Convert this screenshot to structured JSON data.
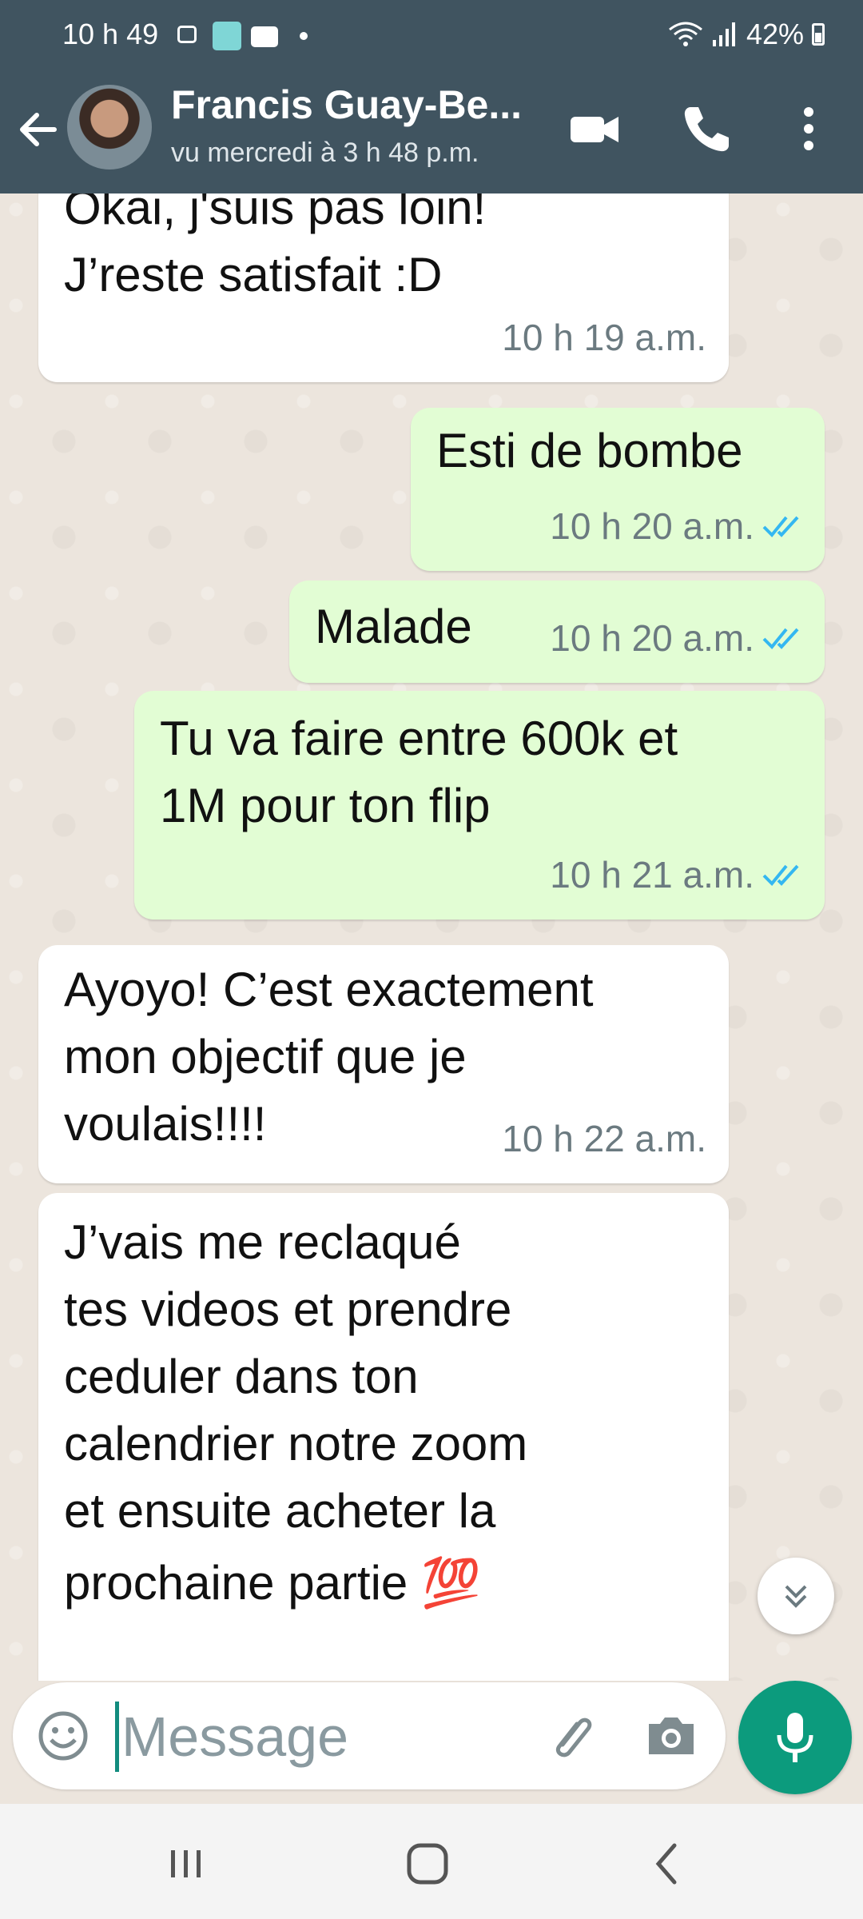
{
  "status_bar": {
    "time": "10 h 49",
    "battery": "42%"
  },
  "header": {
    "contact_name": "Francis Guay-Be...",
    "last_seen": "vu mercredi à 3 h 48 p.m."
  },
  "messages": [
    {
      "direction": "incoming",
      "lines": [
        "Okai, j'suis pas loin!",
        "J’reste satisfait :D"
      ],
      "time": "10 h 19 a.m."
    },
    {
      "direction": "outgoing",
      "lines": [
        "Esti de bombe"
      ],
      "time": "10 h 20 a.m.",
      "status": "read"
    },
    {
      "direction": "outgoing",
      "lines": [
        "Malade"
      ],
      "time": "10 h 20 a.m.",
      "status": "read"
    },
    {
      "direction": "outgoing",
      "lines": [
        "Tu va faire entre 600k et",
        "1M pour ton flip"
      ],
      "time": "10 h 21 a.m.",
      "status": "read"
    },
    {
      "direction": "incoming",
      "lines": [
        "Ayoyo! C’est exactement",
        "mon objectif que je",
        "voulais!!!!"
      ],
      "time": "10 h 22 a.m."
    },
    {
      "direction": "incoming",
      "lines": [
        "J’vais me reclaqué",
        "tes videos et prendre",
        "ceduler dans ton",
        "calendrier notre zoom",
        "et ensuite acheter la",
        "prochaine partie 💯"
      ],
      "time": ""
    }
  ],
  "composer": {
    "placeholder": "Message"
  },
  "icons": {
    "back": "arrow-left-icon",
    "video": "video-call-icon",
    "call": "phone-icon",
    "menu": "more-vert-icon",
    "emoji": "emoji-icon",
    "attach": "paperclip-icon",
    "camera": "camera-icon",
    "mic": "microphone-icon",
    "scroll": "double-chevron-down-icon",
    "read_receipt": "double-check-icon"
  },
  "colors": {
    "header": "#405460",
    "outgoing_bubble": "#e2fdd4",
    "incoming_bubble": "#ffffff",
    "accent": "#0c9b7d",
    "read_ticks": "#34b7f1"
  }
}
